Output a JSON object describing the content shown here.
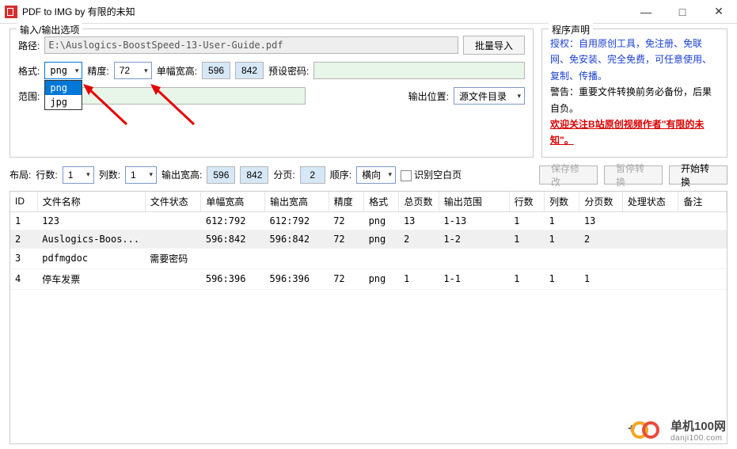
{
  "window": {
    "title": "PDF to IMG  by 有限的未知"
  },
  "io": {
    "legend": "输入/输出选项",
    "path_label": "路径:",
    "path_value": "E:\\Auslogics-BoostSpeed-13-User-Guide.pdf",
    "batch_import": "批量导入",
    "format_label": "格式:",
    "format_value": "png",
    "format_options": [
      "png",
      "jpg"
    ],
    "dpi_label": "精度:",
    "dpi_value": "72",
    "single_wh_label": "单幅宽高:",
    "single_w": "596",
    "single_h": "842",
    "preset_pwd_label": "预设密码:",
    "range_label": "范围:",
    "output_pos_label": "输出位置:",
    "output_pos_value": "源文件目录"
  },
  "about": {
    "legend": "程序声明",
    "line1": "授权：自用原创工具，免注册、免联网、免安装、完全免费，可任意使用、复制、传播。",
    "line2": "警告：重要文件转换前务必备份，后果自负。",
    "line3a": "欢迎关注",
    "line3b": "B",
    "line3c": "站原创视频作者\"有限的未知\"。"
  },
  "layout": {
    "layout_label": "布局:",
    "rows_label": "行数:",
    "rows_value": "1",
    "cols_label": "列数:",
    "cols_value": "1",
    "out_wh_label": "输出宽高:",
    "out_w": "596",
    "out_h": "842",
    "page_label": "分页:",
    "page_value": "2",
    "order_label": "顺序:",
    "order_value": "横向",
    "detect_blank": "识别空白页",
    "save_btn": "保存修改",
    "pause_btn": "暂停转换",
    "start_btn": "开始转换"
  },
  "table": {
    "headers": [
      "ID",
      "文件名称",
      "文件状态",
      "单幅宽高",
      "输出宽高",
      "精度",
      "格式",
      "总页数",
      "输出范围",
      "行数",
      "列数",
      "分页数",
      "处理状态",
      "备注"
    ],
    "rows": [
      {
        "id": "1",
        "name": "123",
        "status": "",
        "single": "612:792",
        "out": "612:792",
        "dpi": "72",
        "fmt": "png",
        "pages": "13",
        "range": "1-13",
        "rows": "1",
        "cols": "1",
        "split": "13",
        "proc": "",
        "note": ""
      },
      {
        "id": "2",
        "name": "Auslogics-Boos...",
        "status": "",
        "single": "596:842",
        "out": "596:842",
        "dpi": "72",
        "fmt": "png",
        "pages": "2",
        "range": "1-2",
        "rows": "1",
        "cols": "1",
        "split": "2",
        "proc": "",
        "note": "",
        "selected": true
      },
      {
        "id": "3",
        "name": "pdfmgdoc",
        "status": "需要密码",
        "single": "",
        "out": "",
        "dpi": "",
        "fmt": "",
        "pages": "",
        "range": "",
        "rows": "",
        "cols": "",
        "split": "",
        "proc": "",
        "note": ""
      },
      {
        "id": "4",
        "name": "停车发票",
        "status": "",
        "single": "596:396",
        "out": "596:396",
        "dpi": "72",
        "fmt": "png",
        "pages": "1",
        "range": "1-1",
        "rows": "1",
        "cols": "1",
        "split": "1",
        "proc": "",
        "note": ""
      }
    ]
  },
  "watermark": {
    "text": "单机100网",
    "sub": "danji100.com"
  }
}
